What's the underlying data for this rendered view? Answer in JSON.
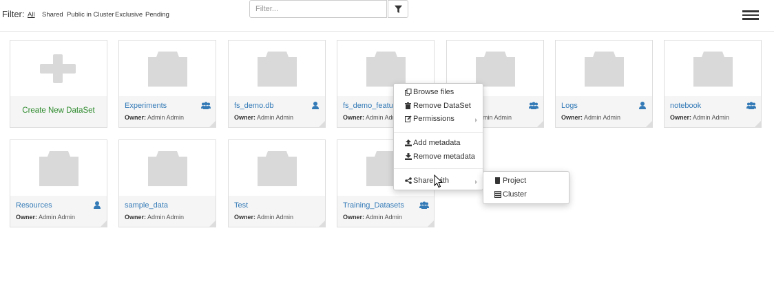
{
  "filter": {
    "label": "Filter:",
    "options": [
      "All",
      "Shared",
      "Public in Cluster",
      "Exclusive",
      "Pending"
    ],
    "active": "All"
  },
  "search": {
    "placeholder": "Filter..."
  },
  "create": {
    "label": "Create New DataSet"
  },
  "owner_prefix": "Owner:",
  "datasets": [
    {
      "name": "Experiments",
      "owner": "Admin Admin",
      "share": "users-icon"
    },
    {
      "name": "fs_demo.db",
      "owner": "Admin Admin",
      "share": "user-icon"
    },
    {
      "name": "fs_demo_featur",
      "owner": "Admin Admin",
      "share": "none"
    },
    {
      "name": "",
      "owner": "Admin Admin",
      "share": "users-icon"
    },
    {
      "name": "Logs",
      "owner": "Admin Admin",
      "share": "user-icon"
    },
    {
      "name": "notebook",
      "owner": "Admin Admin",
      "share": "users-icon"
    },
    {
      "name": "Resources",
      "owner": "Admin Admin",
      "share": "user-icon"
    },
    {
      "name": "sample_data",
      "owner": "Admin Admin",
      "share": "none"
    },
    {
      "name": "Test",
      "owner": "Admin Admin",
      "share": "none"
    },
    {
      "name": "Training_Datasets",
      "owner": "Admin Admin",
      "share": "users-icon"
    }
  ],
  "context_menu": {
    "browse_files": "Browse files",
    "remove_dataset": "Remove DataSet",
    "permissions": "Permissions",
    "add_metadata": "Add metadata",
    "remove_metadata": "Remove metadata",
    "share_with": "Share with"
  },
  "share_submenu": {
    "project": "Project",
    "cluster": "Cluster"
  },
  "colors": {
    "link": "#337ab7",
    "create": "#2d8a2d",
    "folder": "#d9d9d9",
    "share_icon": "#337ab7"
  }
}
